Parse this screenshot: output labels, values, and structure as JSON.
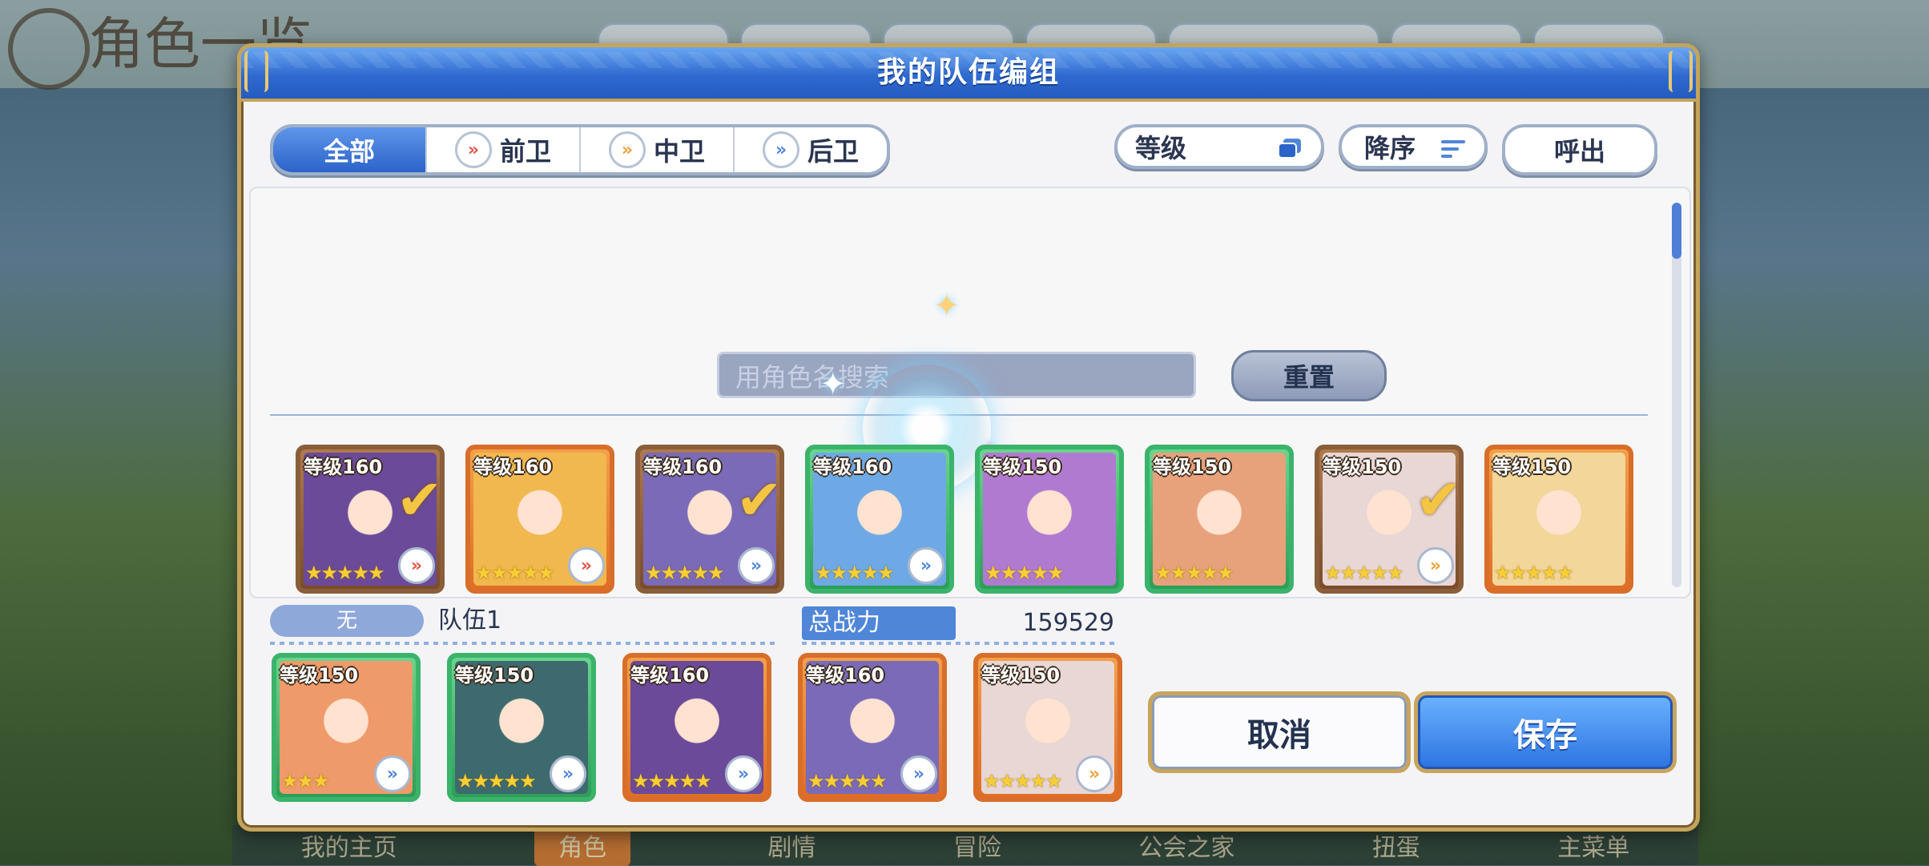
{
  "background": {
    "title": "角色一览",
    "nav": [
      "我的主页",
      "角色",
      "剧情",
      "冒险",
      "公会之家",
      "扭蛋",
      "主菜单"
    ]
  },
  "dialog": {
    "title": "我的队伍编组",
    "tabs": [
      "全部",
      "前卫",
      "中卫",
      "后卫"
    ],
    "sort_field": "等级",
    "sort_order": "降序",
    "call_label": "呼出",
    "search_placeholder": "用角色名搜索",
    "reset_label": "重置"
  },
  "roster": [
    {
      "level": "等级160",
      "stars": "★★★★★",
      "role": "front",
      "checked": true,
      "frame": "silver",
      "art": "#6b4a9a"
    },
    {
      "level": "等级160",
      "stars": "★★★★★",
      "role": "front",
      "checked": false,
      "frame": "gold",
      "art": "#f1b84f"
    },
    {
      "level": "等级160",
      "stars": "★★★★★",
      "role": "back",
      "checked": true,
      "frame": "silver",
      "art": "#7a6ab8"
    },
    {
      "level": "等级160",
      "stars": "★★★★★",
      "role": "back",
      "checked": false,
      "frame": "green",
      "art": "#6ea9e6"
    },
    {
      "level": "等级150",
      "stars": "★★★★★",
      "role": "",
      "checked": false,
      "frame": "green",
      "art": "#b07ad0"
    },
    {
      "level": "等级150",
      "stars": "★★★★★",
      "role": "",
      "checked": false,
      "frame": "green",
      "art": "#e7a27c"
    },
    {
      "level": "等级150",
      "stars": "★★★★★",
      "role": "mid",
      "checked": true,
      "frame": "silver",
      "art": "#e9d7d6"
    },
    {
      "level": "等级150",
      "stars": "★★★★★",
      "role": "",
      "checked": false,
      "frame": "gold",
      "art": "#f2d69a"
    }
  ],
  "team": {
    "tag": "无",
    "name": "队伍1",
    "power_label": "总战力",
    "power_value": "159529",
    "members": [
      {
        "level": "等级150",
        "stars": "★★★",
        "role": "back",
        "frame": "green",
        "art": "#ee9a6a"
      },
      {
        "level": "等级150",
        "stars": "★★★★★",
        "role": "back",
        "frame": "green",
        "art": "#3d6a6e"
      },
      {
        "level": "等级160",
        "stars": "★★★★★",
        "role": "back",
        "frame": "gold",
        "art": "#6b4a9a"
      },
      {
        "level": "等级160",
        "stars": "★★★★★",
        "role": "back",
        "frame": "gold",
        "art": "#7a6ab8"
      },
      {
        "level": "等级150",
        "stars": "★★★★★",
        "role": "mid",
        "frame": "gold",
        "art": "#e9d7d6"
      }
    ]
  },
  "buttons": {
    "cancel": "取消",
    "save": "保存"
  }
}
